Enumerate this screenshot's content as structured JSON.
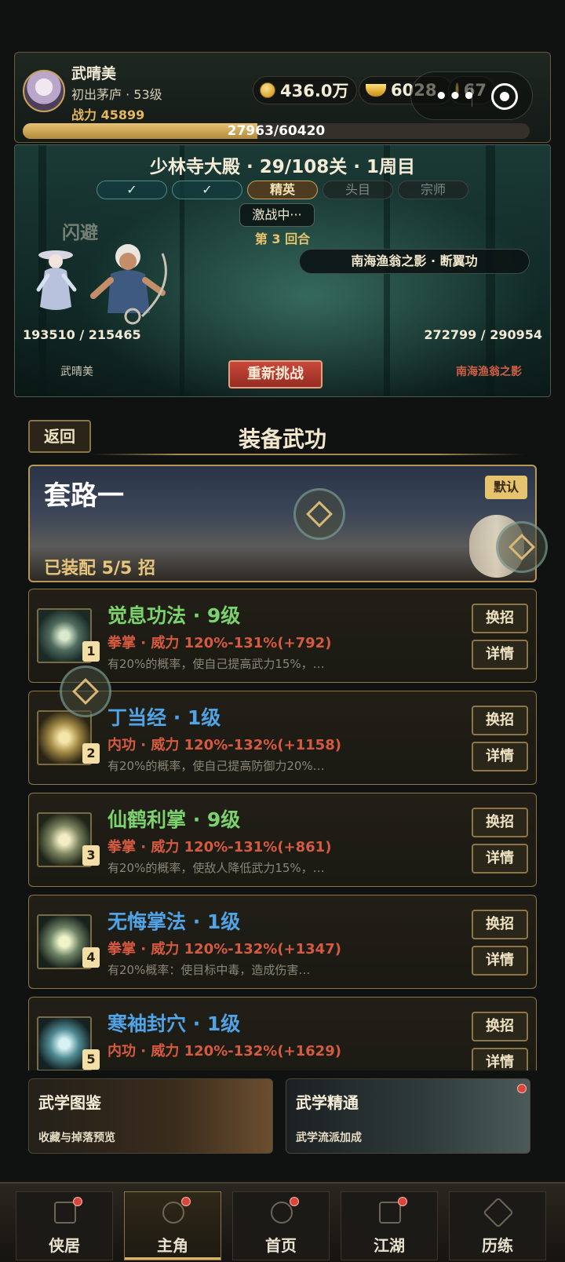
{
  "player": {
    "name": "武晴美",
    "rank": "初出茅庐 · 53级",
    "power": "战力 45899",
    "xp_text": "27963/60420",
    "xp_progress": 0.463
  },
  "currencies": {
    "silver": "436.0万",
    "gold_ingot": "6028",
    "gem": "67"
  },
  "battle": {
    "stage": "少林寺大殿 · 29/108关 · 1周目",
    "difficulty_tabs": [
      {
        "label": "✓",
        "state": "done"
      },
      {
        "label": "✓",
        "state": "done"
      },
      {
        "label": "精英",
        "state": "active"
      },
      {
        "label": "头目",
        "state": "locked"
      },
      {
        "label": "宗师",
        "state": "locked"
      }
    ],
    "status": "激战中···",
    "round": "第 3 回合",
    "float_text": "闪避",
    "enemy_skill": "南海渔翁之影 · 断翼功",
    "player_hp": "193510 / 215465",
    "enemy_hp": "272799 / 290954",
    "player_name": "武晴美",
    "enemy_name": "南海渔翁之影",
    "retry_label": "重新挑战"
  },
  "equip": {
    "back_label": "返回",
    "title": "装备武功",
    "routine_title": "套路一",
    "routine_count": "已装配 5/5 招",
    "default_badge": "默认",
    "swap_label": "换招",
    "info_label": "详情",
    "skills": [
      {
        "index": "1",
        "name": "觉息功法 · 9级",
        "color": "green",
        "power": "拳掌 · 威力 120%-131%(+792)",
        "desc": "有20%的概率，使自己提高武力15%，…"
      },
      {
        "index": "2",
        "name": "丁当经 · 1级",
        "color": "blue",
        "power": "内功 · 威力 120%-132%(+1158)",
        "desc": "有20%的概率，使自己提高防御力20%…"
      },
      {
        "index": "3",
        "name": "仙鹤利掌 · 9级",
        "color": "green",
        "power": "拳掌 · 威力 120%-131%(+861)",
        "desc": "有20%的概率，使敌人降低武力15%，…"
      },
      {
        "index": "4",
        "name": "无悔掌法 · 1级",
        "color": "blue",
        "power": "拳掌 · 威力 120%-132%(+1347)",
        "desc": "有20%概率：使目标中毒，造成伤害…"
      },
      {
        "index": "5",
        "name": "寒袖封穴 · 1级",
        "color": "blue",
        "power": "内功 · 威力 120%-132%(+1629)",
        "desc": ""
      }
    ]
  },
  "features": [
    {
      "title": "武学图鉴",
      "subtitle": "收藏与掉落预览"
    },
    {
      "title": "武学精通",
      "subtitle": "武学流派加成"
    }
  ],
  "nav": [
    {
      "label": "侠居",
      "icon": "house-icon",
      "badge": true
    },
    {
      "label": "主角",
      "icon": "hero-icon",
      "badge": true
    },
    {
      "label": "首页",
      "icon": "home-icon",
      "badge": true
    },
    {
      "label": "江湖",
      "icon": "jianghu-icon",
      "badge": true
    },
    {
      "label": "历练",
      "icon": "crossed-swords-icon",
      "badge": false
    }
  ],
  "nav_active_index": 1
}
